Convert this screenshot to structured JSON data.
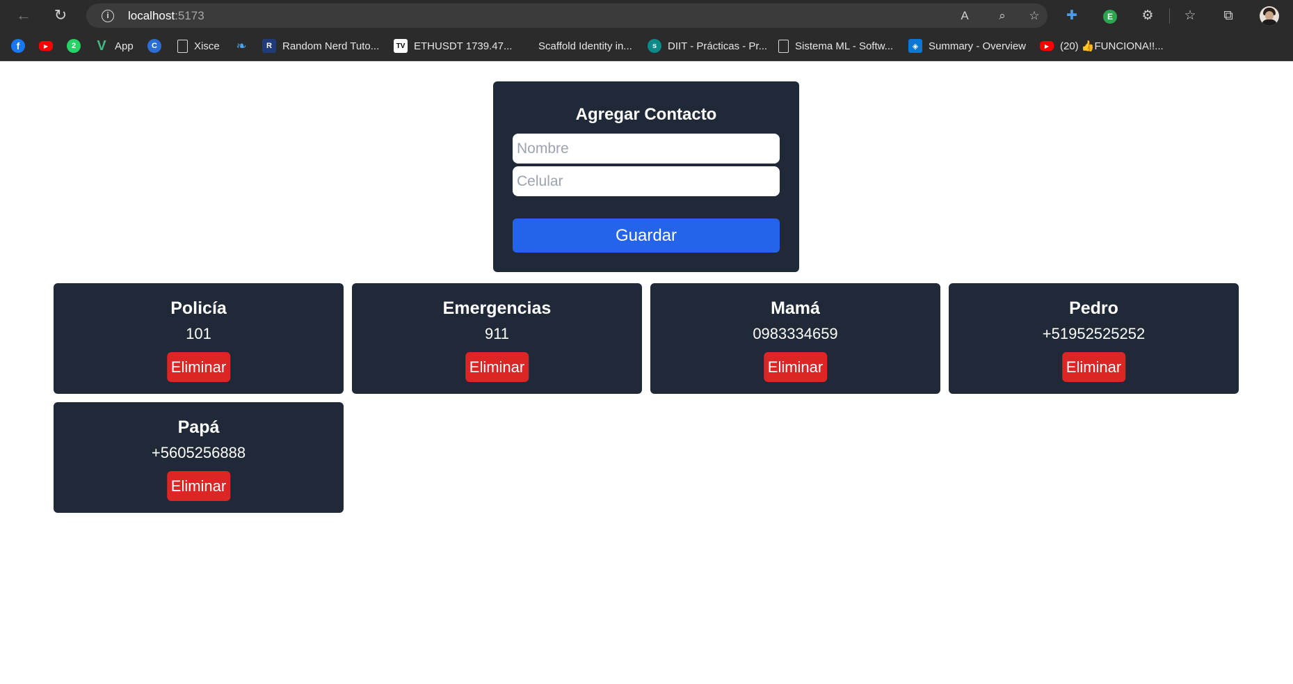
{
  "browser": {
    "url_host": "localhost",
    "url_port": ":5173",
    "bookmarks": [
      {
        "label": "",
        "icon": "facebook-icon"
      },
      {
        "label": "",
        "icon": "youtube-icon"
      },
      {
        "label": "",
        "icon": "whatsapp-icon"
      },
      {
        "label": "App",
        "icon": "vue-icon"
      },
      {
        "label": "",
        "icon": "copilot-icon"
      },
      {
        "label": "Xisce",
        "icon": "document-icon"
      },
      {
        "label": "",
        "icon": "leaf-icon"
      },
      {
        "label": "Random Nerd Tuto...",
        "icon": "rnt-icon"
      },
      {
        "label": "ETHUSDT 1739.47...",
        "icon": "tradingview-icon"
      },
      {
        "label": "Scaffold Identity in...",
        "icon": "microsoft-icon"
      },
      {
        "label": "DIIT - Prácticas - Pr...",
        "icon": "sharepoint-icon"
      },
      {
        "label": "Sistema ML - Softw...",
        "icon": "document-icon"
      },
      {
        "label": "Summary - Overview",
        "icon": "azure-devops-icon"
      },
      {
        "label": "(20) 👍FUNCIONA!!...",
        "icon": "youtube-icon"
      }
    ]
  },
  "form": {
    "title": "Agregar Contacto",
    "name_placeholder": "Nombre",
    "name_value": "",
    "phone_placeholder": "Celular",
    "phone_value": "",
    "save_label": "Guardar"
  },
  "contacts": [
    {
      "name": "Policía",
      "phone": "101",
      "delete_label": "Eliminar"
    },
    {
      "name": "Emergencias",
      "phone": "911",
      "delete_label": "Eliminar"
    },
    {
      "name": "Mamá",
      "phone": "0983334659",
      "delete_label": "Eliminar"
    },
    {
      "name": "Pedro",
      "phone": "+51952525252",
      "delete_label": "Eliminar"
    },
    {
      "name": "Papá",
      "phone": "+5605256888",
      "delete_label": "Eliminar"
    }
  ],
  "colors": {
    "card_bg": "#1f2937",
    "primary_button": "#2563eb",
    "danger_button": "#dc2626",
    "browser_chrome": "#2b2b2b"
  }
}
